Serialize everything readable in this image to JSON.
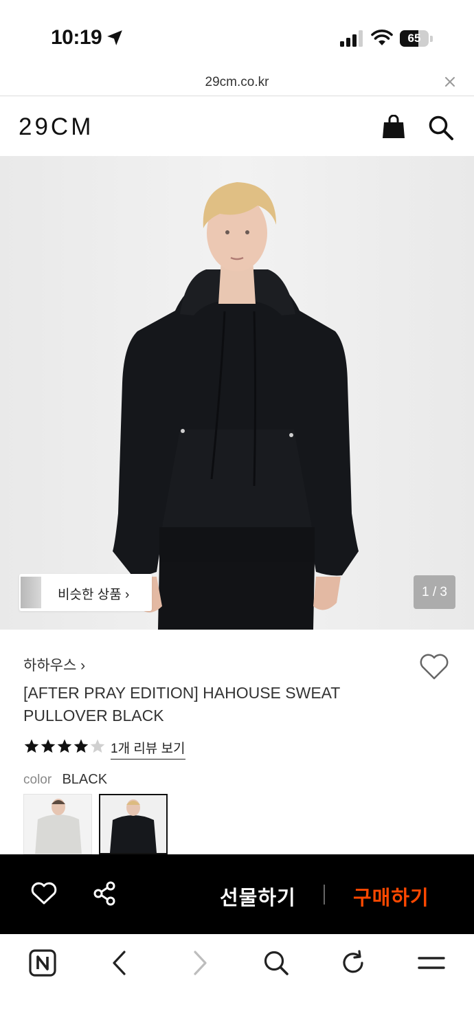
{
  "status_bar": {
    "time": "10:19",
    "battery": "65",
    "battery_level": 0.65,
    "icons": [
      "location-arrow-icon",
      "signal-icon",
      "wifi-icon",
      "battery-icon"
    ]
  },
  "url_bar": {
    "domain": "29cm.co.kr"
  },
  "header": {
    "logo": "29CM",
    "icons": [
      "shopping-bag-icon",
      "search-icon"
    ]
  },
  "hero": {
    "similar_label": "비슷한 상품 ›",
    "page_counter": "1 / 3"
  },
  "product": {
    "brand": "하하우스 ›",
    "title": "[AFTER PRAY EDITION] HAHOUSE SWEAT PULLOVER BLACK",
    "rating": 4,
    "rating_max": 5,
    "review_link": "1개 리뷰 보기",
    "color_label": "color",
    "color_value": "BLACK",
    "color_options": [
      "gray",
      "black"
    ],
    "selected_color_index": 1
  },
  "action_bar": {
    "gift_label": "선물하기",
    "buy_label": "구매하기",
    "buy_color": "#ff4800"
  },
  "browser_toolbar": {
    "icons": [
      "naver-icon",
      "back-icon",
      "forward-icon",
      "search-icon",
      "reload-icon",
      "menu-icon"
    ]
  }
}
